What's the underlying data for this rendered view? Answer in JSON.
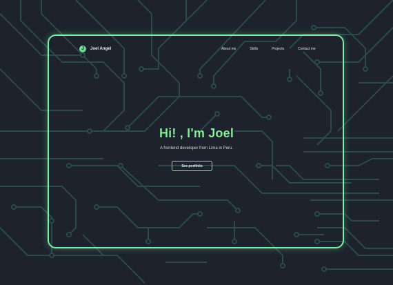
{
  "brand": {
    "name": "Joel Angel",
    "icon": "logo-j-icon",
    "accent": "#7ff0a3"
  },
  "nav": {
    "items": [
      {
        "label": "About me"
      },
      {
        "label": "Skills"
      },
      {
        "label": "Projects"
      },
      {
        "label": "Contact me"
      }
    ]
  },
  "hero": {
    "title": "Hi! , I'm Joel",
    "subtitle": "A frontend developer from Lima in Peru.",
    "cta_label": "See portfolio"
  },
  "colors": {
    "background": "#1d222c",
    "circuit": "#2b4a49",
    "frame": "#7ff0a3"
  }
}
